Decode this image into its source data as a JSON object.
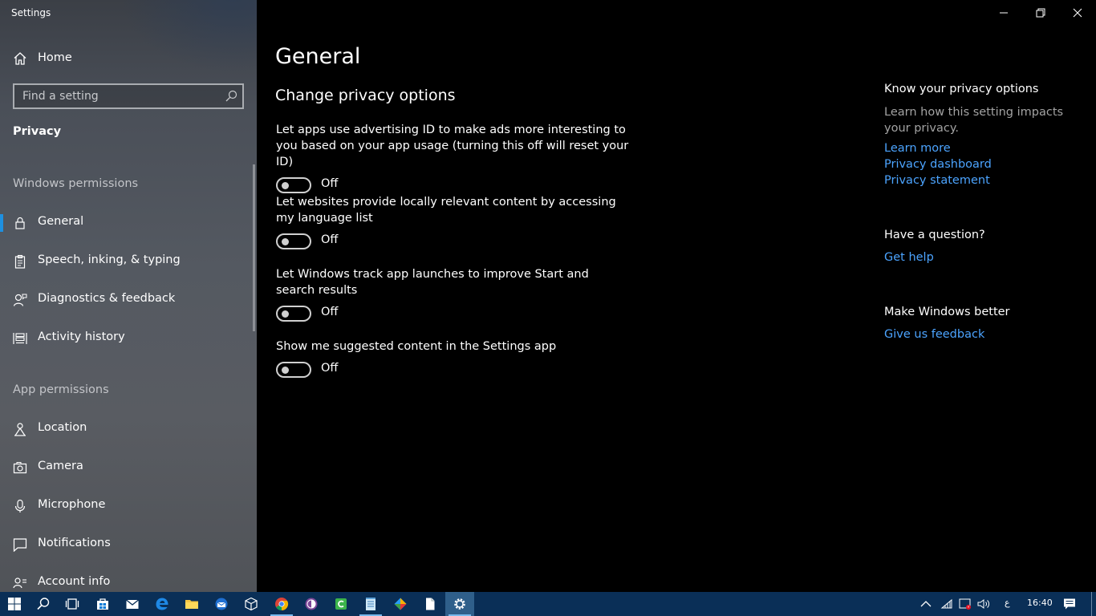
{
  "window": {
    "title": "Settings",
    "controls": {
      "minimize": "minimize",
      "restore": "restore",
      "close": "close"
    }
  },
  "sidebar": {
    "home_label": "Home",
    "search_placeholder": "Find a setting",
    "section_title": "Privacy",
    "windows_permissions_label": "Windows permissions",
    "app_permissions_label": "App permissions",
    "windows_items": [
      {
        "label": "General",
        "icon": "lock-icon",
        "active": true
      },
      {
        "label": "Speech, inking, & typing",
        "icon": "clipboard-icon"
      },
      {
        "label": "Diagnostics & feedback",
        "icon": "feedback-person-icon"
      },
      {
        "label": "Activity history",
        "icon": "activity-history-icon"
      }
    ],
    "app_items": [
      {
        "label": "Location",
        "icon": "location-icon"
      },
      {
        "label": "Camera",
        "icon": "camera-icon"
      },
      {
        "label": "Microphone",
        "icon": "microphone-icon"
      },
      {
        "label": "Notifications",
        "icon": "notifications-icon"
      },
      {
        "label": "Account info",
        "icon": "account-info-icon"
      }
    ]
  },
  "main": {
    "title": "General",
    "subheading": "Change privacy options",
    "settings": [
      {
        "description": "Let apps use advertising ID to make ads more interesting to you based on your app usage (turning this off will reset your ID)",
        "state": "Off"
      },
      {
        "description": "Let websites provide locally relevant content by accessing my language list",
        "state": "Off"
      },
      {
        "description": "Let Windows track app launches to improve Start and search results",
        "state": "Off"
      },
      {
        "description": "Show me suggested content in the Settings app",
        "state": "Off"
      }
    ]
  },
  "right_panel": {
    "privacy_title": "Know your privacy options",
    "privacy_text": "Learn how this setting impacts your privacy.",
    "links": [
      "Learn more",
      "Privacy dashboard",
      "Privacy statement"
    ],
    "question_title": "Have a question?",
    "help_link": "Get help",
    "better_title": "Make Windows better",
    "feedback_link": "Give us feedback"
  },
  "taskbar": {
    "apps": [
      "start-icon",
      "search-icon",
      "task-view-icon",
      "store-icon",
      "mail-icon",
      "edge-icon",
      "file-explorer-icon",
      "thunderbird-icon",
      "3d-viewer-icon",
      "chrome-icon",
      "tor-browser-icon",
      "camtasia-icon",
      "notepad-icon",
      "app-icon",
      "file-icon",
      "settings-icon"
    ],
    "language": "ع",
    "time": "16:40"
  },
  "colors": {
    "accent": "#1e90e0",
    "link": "#4ca4ff",
    "taskbar": "#0a2f57"
  }
}
